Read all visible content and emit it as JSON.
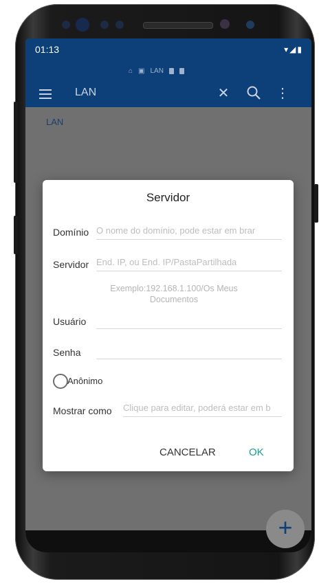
{
  "status": {
    "time": "01:13",
    "icons_text": "▾◢▮"
  },
  "appbar": {
    "title": "LAN",
    "breadcrumb_label": "LAN",
    "icons": [
      "menu-icon",
      "close-icon",
      "search-icon",
      "more-vert-icon"
    ]
  },
  "content": {
    "path_label": "LAN"
  },
  "dialog": {
    "title": "Servidor",
    "domain_label": "Domínio",
    "domain_placeholder": "O nome do domínio, pode estar em brar",
    "server_label": "Servidor",
    "server_placeholder": "End. IP, ou End. IP/PastaPartilhada",
    "example_hint": "Exemplo:192.168.1.100/Os Meus Documentos",
    "user_label": "Usuário",
    "user_value": "",
    "password_label": "Senha",
    "password_value": "",
    "anonymous_label": "Anônimo",
    "display_label": "Mostrar como",
    "display_placeholder": "Clique para editar, poderá estar em b",
    "cancel": "CANCELAR",
    "ok": "OK"
  },
  "fab": {
    "label": "+"
  },
  "colors": {
    "appbar": "#0d3f78",
    "accent": "#1a9c8c",
    "overlay": "#707070"
  }
}
